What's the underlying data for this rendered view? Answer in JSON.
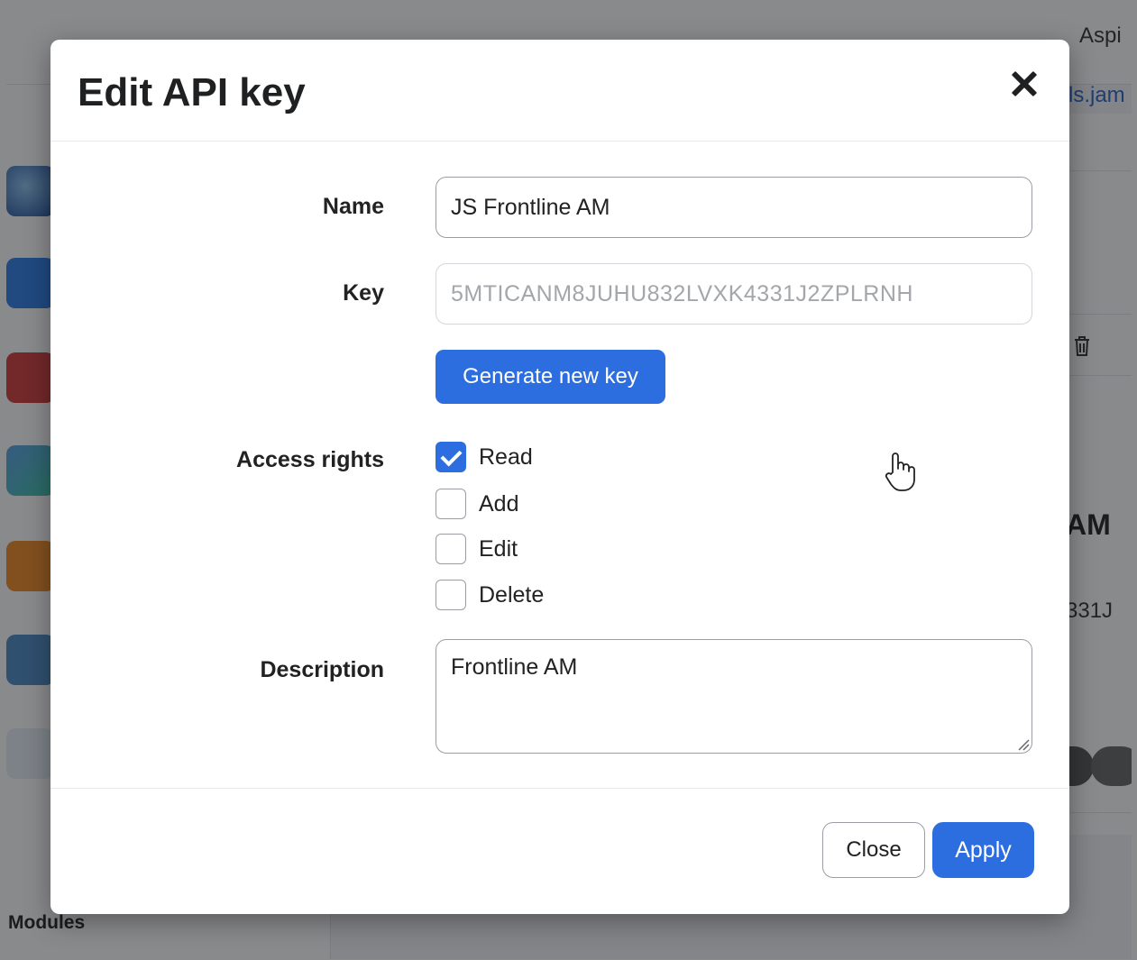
{
  "background": {
    "header_text": "Aspi",
    "link_text": "ls.jam",
    "partial_title": "AM",
    "partial_key": "331J",
    "sidebar_section": "Modules",
    "app_icons": [
      "globe-app-icon",
      "app-store-icon",
      "device-app-icon",
      "blocks-app-icon",
      "presentation-app-icon",
      "calendar-app-icon",
      "tablet-app-icon"
    ]
  },
  "modal": {
    "title": "Edit API key",
    "close_icon": "close-icon",
    "name_label": "Name",
    "name_value": "JS Frontline AM",
    "key_label": "Key",
    "key_value": "5MTICANM8JUHU832LVXK4331J2ZPLRNH",
    "generate_button": "Generate new key",
    "access_label": "Access rights",
    "access_rights": [
      {
        "label": "Read",
        "checked": true
      },
      {
        "label": "Add",
        "checked": false
      },
      {
        "label": "Edit",
        "checked": false
      },
      {
        "label": "Delete",
        "checked": false
      }
    ],
    "description_label": "Description",
    "description_value": "Frontline AM",
    "close_button": "Close",
    "apply_button": "Apply"
  },
  "colors": {
    "primary": "#2c6ee0",
    "overlay": "rgba(20,22,26,0.5)",
    "text": "#222222"
  }
}
